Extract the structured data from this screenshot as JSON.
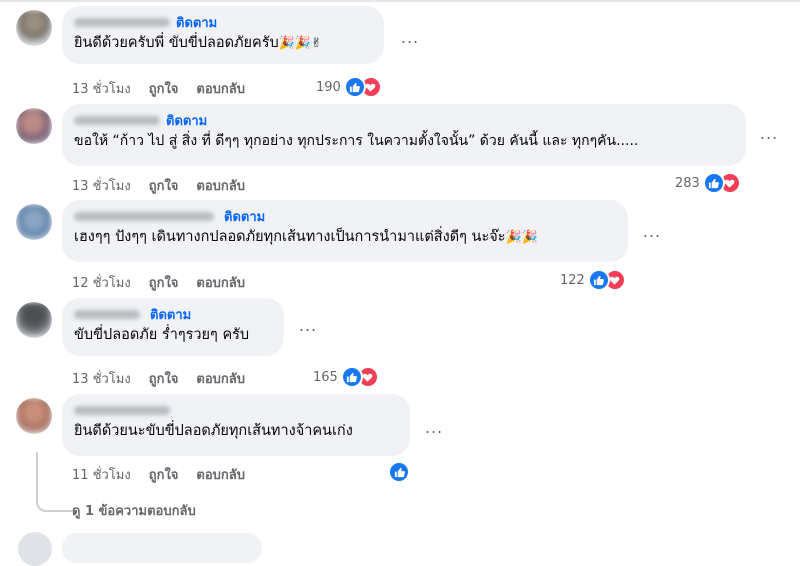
{
  "comments": [
    {
      "follow": "ติดตาม",
      "text": "ยินดีด้วยครับพี่ ขับขี่ปลอดภัยครับ",
      "emoji": "🎉🎉✌",
      "time": "13 ชั่วโมง",
      "like": "ถูกใจ",
      "reply": "ตอบกลับ",
      "count": "190",
      "reactions": [
        "like",
        "love"
      ]
    },
    {
      "follow": "ติดตาม",
      "text": "ขอให้ “ก้าว ไป สู่ สิ่ง ที่ ดีๆๆ ทุกอย่าง ทุกประการ ในความตั้งใจนั้น” ด้วย คันนี้ และ ทุกๆคัน.....",
      "emoji": "",
      "time": "13 ชั่วโมง",
      "like": "ถูกใจ",
      "reply": "ตอบกลับ",
      "count": "283",
      "reactions": [
        "like",
        "love"
      ]
    },
    {
      "follow": "ติดตาม",
      "text": "เฮงๆๆ ปังๆๆ เดินทางกปลอดภัยทุกเส้นทางเป็นการนำมาแต่สิ่งดีๆ นะจ๊ะ",
      "emoji": "🎉🎉",
      "time": "12 ชั่วโมง",
      "like": "ถูกใจ",
      "reply": "ตอบกลับ",
      "count": "122",
      "reactions": [
        "like",
        "love"
      ]
    },
    {
      "follow": "ติดตาม",
      "text": "ขับขี่ปลอดภัย ร่ำๆรวยๆ ครับ",
      "emoji": "",
      "time": "13 ชั่วโมง",
      "like": "ถูกใจ",
      "reply": "ตอบกลับ",
      "count": "165",
      "reactions": [
        "like",
        "love"
      ]
    },
    {
      "follow": "",
      "text": "ยินดีด้วยนะขับขี่ปลอดภัยทุกเส้นทางจ้าคนเก่ง",
      "emoji": "",
      "time": "11 ชั่วโมง",
      "like": "ถูกใจ",
      "reply": "ตอบกลับ",
      "count": "",
      "reactions": [
        "like"
      ]
    }
  ],
  "view_replies": "ดู 1 ข้อความตอบกลับ",
  "more_label": "...",
  "colors": {
    "accent": "#0866ff",
    "like": "#1877f2",
    "love": "#f33e58",
    "bubble": "#f0f2f5",
    "meta": "#65676b"
  },
  "icons": {
    "like": "thumbs-up-icon",
    "love": "heart-icon",
    "more": "more-options-icon"
  }
}
